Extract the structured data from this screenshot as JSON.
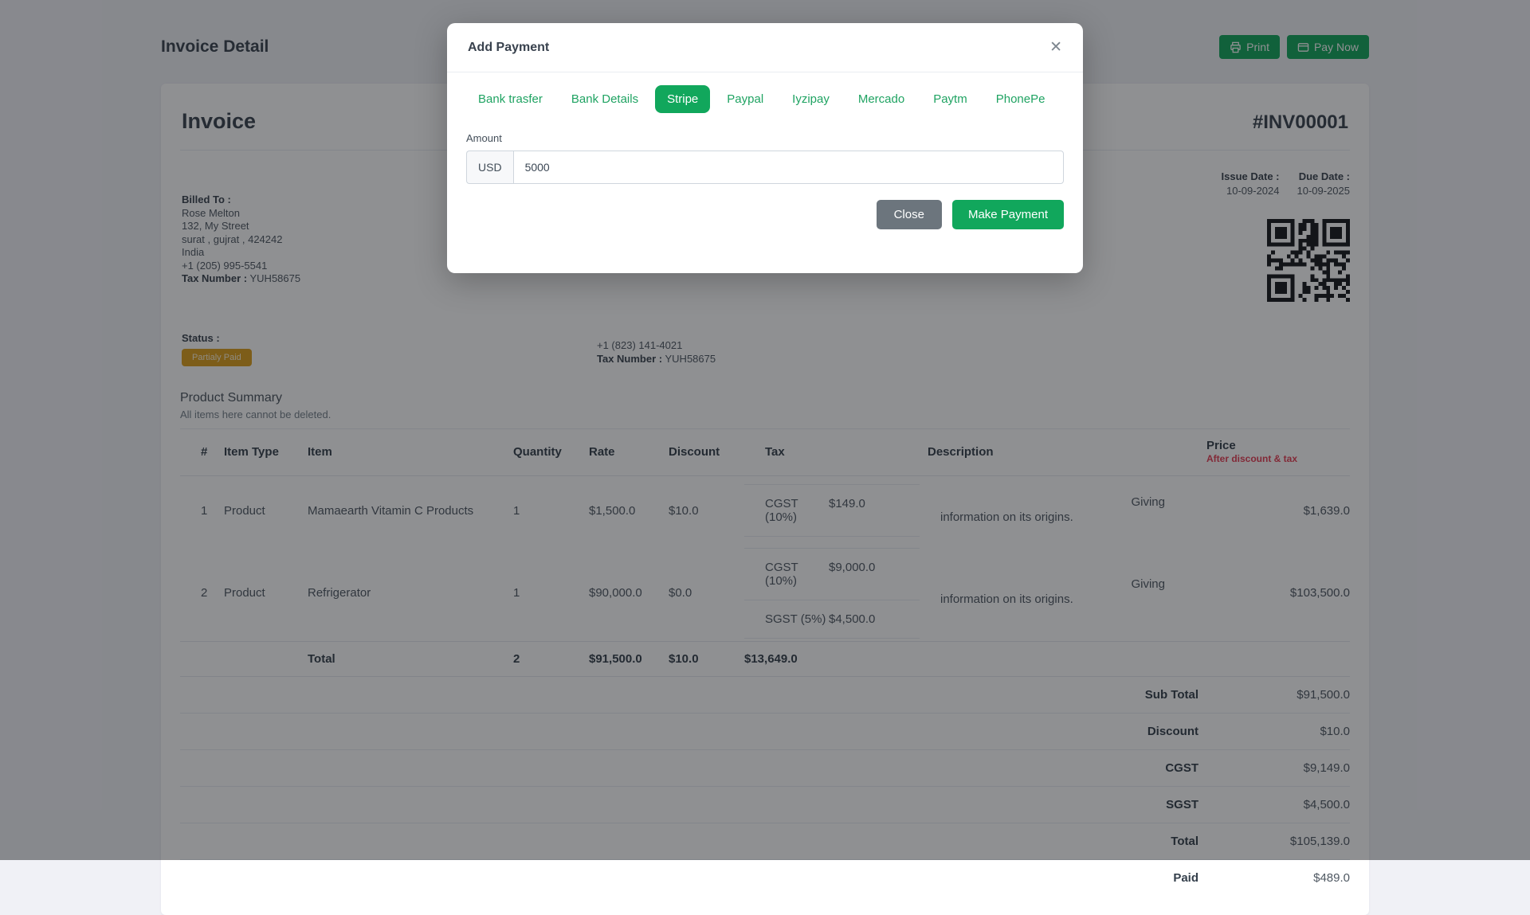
{
  "colors": {
    "accent_green": "#11a75c",
    "warning_badge": "#dd9f1b",
    "danger_red": "#e63e54"
  },
  "page": {
    "title": "Invoice Detail",
    "print_label": "Print",
    "pay_now_label": "Pay Now"
  },
  "invoice": {
    "heading": "Invoice",
    "number": "#INV00001",
    "billed_to": {
      "label": "Billed To :",
      "name": "Rose Melton",
      "address1": "132, My Street",
      "address2": "surat , gujrat , 424242",
      "country": "India",
      "phone": "+1 (205) 995-5541",
      "tax_label": "Tax Number :",
      "tax_value": "YUH58675"
    },
    "shipped_visible": {
      "phone": "+1 (823) 141-4021",
      "tax_label": "Tax Number :",
      "tax_value": "YUH58675"
    },
    "issue_date_label": "Issue Date :",
    "issue_date": "10-09-2024",
    "due_date_label": "Due Date :",
    "due_date": "10-09-2025",
    "status_label": "Status :",
    "status_badge": "Partialy Paid"
  },
  "product_summary": {
    "title": "Product Summary",
    "subtitle": "All items here cannot be deleted.",
    "columns": {
      "num": "#",
      "item_type": "Item Type",
      "item": "Item",
      "quantity": "Quantity",
      "rate": "Rate",
      "discount": "Discount",
      "tax": "Tax",
      "description": "Description",
      "price": "Price",
      "price_sub": "After discount & tax"
    },
    "rows": [
      {
        "num": "1",
        "item_type": "Product",
        "item": "Mamaearth Vitamin C Products",
        "quantity": "1",
        "rate": "$1,500.0",
        "discount": "$10.0",
        "taxes": [
          {
            "name": "CGST (10%)",
            "value": "$149.0"
          }
        ],
        "desc_line1": "Giving",
        "desc_line2": "information on its origins.",
        "price": "$1,639.0"
      },
      {
        "num": "2",
        "item_type": "Product",
        "item": "Refrigerator",
        "quantity": "1",
        "rate": "$90,000.0",
        "discount": "$0.0",
        "taxes": [
          {
            "name": "CGST (10%)",
            "value": "$9,000.0"
          },
          {
            "name": "SGST (5%)",
            "value": "$4,500.0"
          }
        ],
        "desc_line1": "Giving",
        "desc_line2": "information on its origins.",
        "price": "$103,500.0"
      }
    ],
    "total_row": {
      "label": "Total",
      "quantity": "2",
      "rate": "$91,500.0",
      "discount": "$10.0",
      "tax": "$13,649.0"
    },
    "summary": [
      {
        "label": "Sub Total",
        "value": "$91,500.0"
      },
      {
        "label": "Discount",
        "value": "$10.0"
      },
      {
        "label": "CGST",
        "value": "$9,149.0"
      },
      {
        "label": "SGST",
        "value": "$4,500.0"
      },
      {
        "label": "Total",
        "value": "$105,139.0"
      },
      {
        "label": "Paid",
        "value": "$489.0"
      }
    ]
  },
  "modal": {
    "title": "Add Payment",
    "close_icon": "✕",
    "tabs": [
      {
        "label": "Bank trasfer"
      },
      {
        "label": "Bank Details"
      },
      {
        "label": "Stripe"
      },
      {
        "label": "Paypal"
      },
      {
        "label": "Iyzipay"
      },
      {
        "label": "Mercado"
      },
      {
        "label": "Paytm"
      },
      {
        "label": "PhonePe"
      }
    ],
    "active_tab": "Stripe",
    "amount_label": "Amount",
    "currency": "USD",
    "amount_value": "5000",
    "close_label": "Close",
    "make_payment_label": "Make Payment"
  }
}
